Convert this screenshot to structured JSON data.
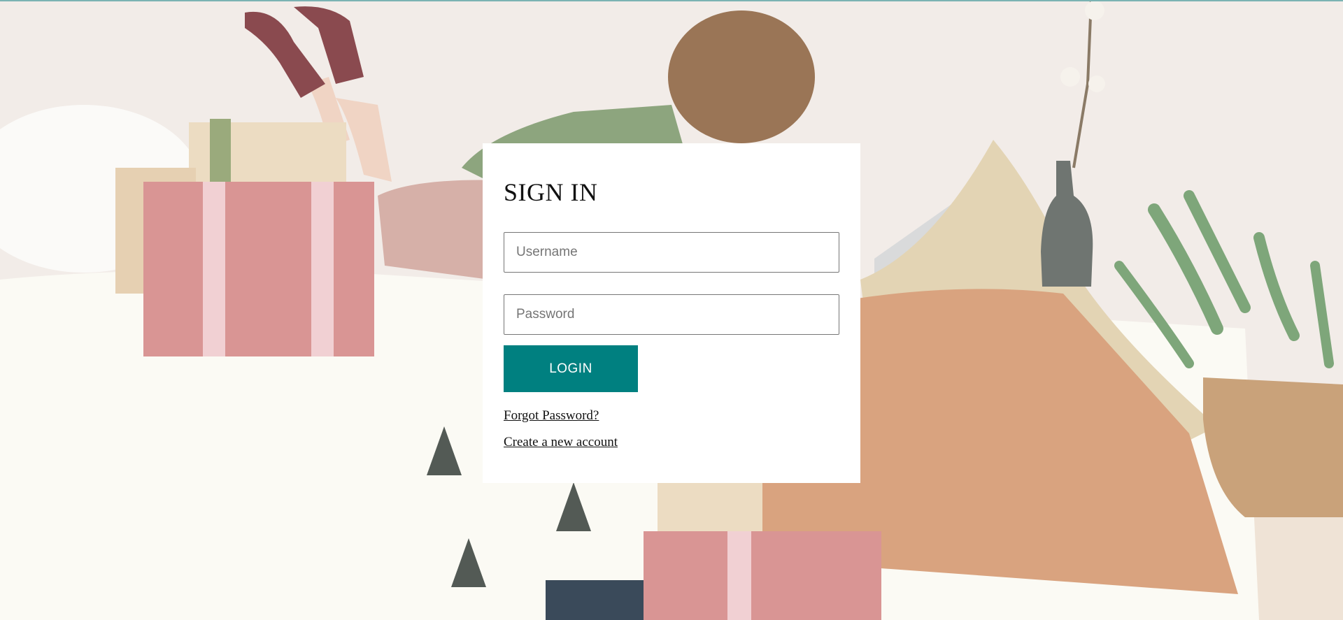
{
  "signin": {
    "title": "SIGN IN",
    "username_placeholder": "Username",
    "password_placeholder": "Password",
    "login_label": "LOGIN",
    "forgot_label": "Forgot Password?",
    "create_label": "Create a new account"
  },
  "colors": {
    "accent": "#008080",
    "card_background": "#ffffff",
    "top_border": "#7bb3b3"
  }
}
